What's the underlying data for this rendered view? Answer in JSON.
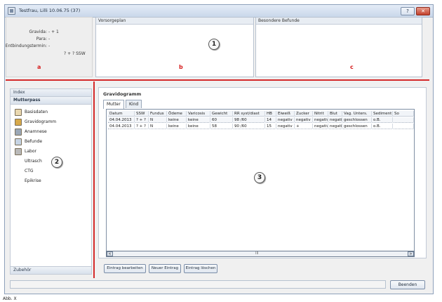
{
  "window": {
    "title": "Testfrau, Lilli 10.06.75 (37)"
  },
  "titlebar": {
    "help_label": "?",
    "close_label": "✕"
  },
  "info_panel": {
    "rows": [
      {
        "label": "Gravida:",
        "value": "- + 1"
      },
      {
        "label": "Para:",
        "value": "-"
      },
      {
        "label": "Entbindungstermin:",
        "value": "-"
      },
      {
        "label": "",
        "value": "? + ? SSW"
      }
    ]
  },
  "panes": {
    "vorsorgeplan": "Vorsorgeplan",
    "befunde": "Besondere Befunde"
  },
  "markers": {
    "m1": "1",
    "m2": "2",
    "m3": "3",
    "a": "a",
    "b": "b",
    "c": "c"
  },
  "nav": {
    "index": "Index",
    "mutterpass": "Mutterpass",
    "items": [
      {
        "label": "Basisdaten",
        "icon": "basisdaten-icon"
      },
      {
        "label": "Gravidogramm",
        "icon": "gravidogramm-icon"
      },
      {
        "label": "Anamnese",
        "icon": "anamnese-icon"
      },
      {
        "label": "Befunde",
        "icon": "befunde-icon"
      },
      {
        "label": "Labor",
        "icon": "labor-icon"
      }
    ],
    "subitems": [
      "Ultrasch",
      "CTG",
      "Epikrise"
    ],
    "footer": "Zubehör"
  },
  "main": {
    "title": "Gravidogramm",
    "tabs": [
      "Mutter",
      "Kind"
    ],
    "columns": [
      "Datum",
      "SSW",
      "Fundus",
      "Ödeme",
      "Varicosis",
      "Gewicht",
      "RR syst/diast",
      "HB",
      "Eiweiß",
      "Zucker",
      "Nitrit",
      "Blut",
      "Vag. Unters.",
      "Sediment",
      "So"
    ],
    "rows": [
      [
        "04.04.2013",
        "? + ?",
        "N",
        "keine",
        "keine",
        "60",
        "98 /60",
        "14",
        "negativ",
        "negativ",
        "negativ",
        "negativ",
        "geschlossen",
        "o.B.",
        ""
      ],
      [
        "04.04.2013",
        "? + ?",
        "N",
        "keine",
        "keine",
        "58",
        "90 /60",
        "15",
        "negativ",
        "+",
        "negativ",
        "negativ",
        "geschlossen",
        "o.B.",
        ""
      ]
    ],
    "scroll_mid": "III",
    "scroll_left": "<",
    "scroll_right": ">"
  },
  "buttons": {
    "edit": "Eintrag bearbeiten",
    "new": "Neuer Eintrag",
    "delete": "Eintrag löschen",
    "exit": "Beenden"
  },
  "caption": "Abb. X"
}
